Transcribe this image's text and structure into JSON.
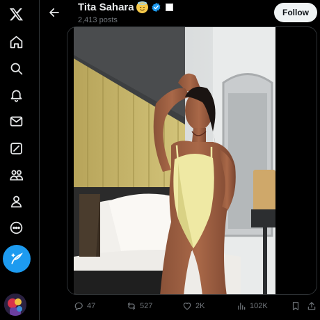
{
  "nav": {
    "items": [
      {
        "name": "x-logo-icon"
      },
      {
        "name": "home-icon"
      },
      {
        "name": "explore-icon"
      },
      {
        "name": "notifications-icon"
      },
      {
        "name": "messages-icon"
      },
      {
        "name": "grok-icon"
      },
      {
        "name": "communities-icon"
      },
      {
        "name": "profile-icon"
      },
      {
        "name": "more-icon"
      }
    ],
    "compose_icon": "compose-post-icon"
  },
  "header": {
    "title": "Tita Sahara",
    "posts_count": "2,413 posts",
    "follow_label": "Follow"
  },
  "actions": {
    "replies": "47",
    "reposts": "527",
    "likes": "2K",
    "views": "102K"
  },
  "colors": {
    "accent": "#1d9bf0",
    "background": "#000000",
    "muted_text": "#71767b",
    "swimsuit": "#efe9a4"
  }
}
